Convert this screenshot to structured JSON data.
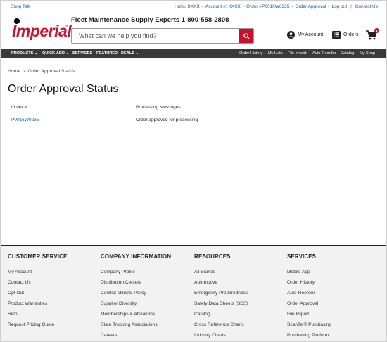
{
  "util_bar": {
    "shop_talk": "Shop Talk",
    "greeting": "Hello, XXXX",
    "account": "Account #: XXXX",
    "order": "Order #P0016W0235",
    "order_approval": "Order Approval",
    "logout": "Log out",
    "contact_us": "Contact Us"
  },
  "header": {
    "logo_text": "Imperial",
    "tagline": "Fleet Maintenance Supply Experts  1-800-558-2808",
    "search_placeholder": "What can we help you find?",
    "my_account": "My Account",
    "orders": "Orders",
    "cart_count": "1"
  },
  "nav": {
    "left": [
      "PRODUCTS",
      "QUICK-ADD",
      "SERVICES",
      "FEATURED",
      "DEALS"
    ],
    "right": [
      "Order History",
      "My Lists",
      "File Import",
      "Auto-Reorder",
      "Catalog",
      "My Shop"
    ]
  },
  "breadcrumb": {
    "home": "Home",
    "current": "Order Approval Status"
  },
  "page_title": "Order Approval Status",
  "table": {
    "headers": [
      "Order #",
      "Processing Messages"
    ],
    "rows": [
      {
        "order": "P0016W0235",
        "message": "Order approved for processing"
      }
    ]
  },
  "footer": {
    "columns": [
      {
        "title": "CUSTOMER SERVICE",
        "links": [
          "My Account",
          "Contact Us",
          "Opt Out",
          "Product Warranties",
          "Help",
          "Request Pricing Quote"
        ]
      },
      {
        "title": "COMPANY INFORMATION",
        "links": [
          "Company Profile",
          "Distribution Centers",
          "Conflict Mineral Policy",
          "Supplier Diversity",
          "Memberships & Affiliations",
          "State Trucking Associations",
          "Careers"
        ]
      },
      {
        "title": "RESOURCES",
        "links": [
          "All Brands",
          "Automotive",
          "Emergency Preparedness",
          "Safety Data Sheets (SDS)",
          "Catalog",
          "Cross Reference Charts",
          "Industry Charts"
        ]
      },
      {
        "title": "SERVICES",
        "links": [
          "Mobile App",
          "Order History",
          "Auto-Reorder",
          "Order Approval",
          "File Import",
          "ScanTel® Purchasing",
          "Purchasing Platform"
        ]
      }
    ]
  },
  "colors": {
    "brand_red": "#c8102e",
    "nav_bg": "#3a3a3a",
    "link_blue": "#1a5fb4"
  }
}
